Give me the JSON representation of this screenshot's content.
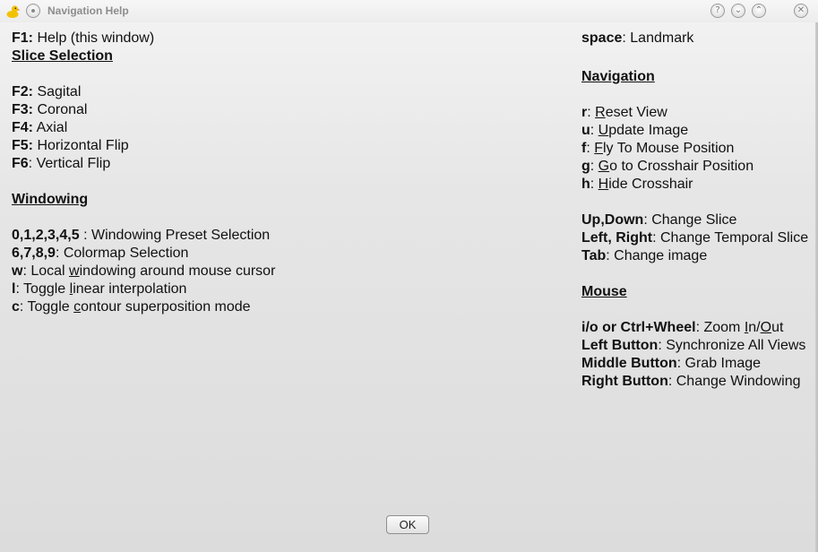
{
  "window": {
    "title": "Navigation Help",
    "buttons": {
      "help": "?",
      "minimize": "⌄",
      "maximize": "⌃",
      "close": "✕"
    }
  },
  "left": {
    "f1": {
      "key": "F1:",
      "desc": " Help (this window)"
    },
    "slice_heading": "Slice Selection",
    "slice_items": [
      {
        "key": "F2:",
        "desc": " Sagital"
      },
      {
        "key": "F3:",
        "desc": " Coronal"
      },
      {
        "key": "F4:",
        "desc": " Axial"
      },
      {
        "key": "F5:",
        "desc": " Horizontal Flip"
      },
      {
        "key": "F6",
        "desc": ": Vertical Flip"
      }
    ],
    "windowing_heading": "Windowing",
    "windowing_items": [
      {
        "key": "0,1,2,3,4,5",
        "pre": " : Windowing Preset Selection",
        "u": "",
        "post": ""
      },
      {
        "key": "6,7,8,9",
        "pre": ": Colormap Selection",
        "u": "",
        "post": ""
      },
      {
        "key": "w",
        "pre": ": Local ",
        "u": "w",
        "post": "indowing around mouse cursor"
      },
      {
        "key": "l",
        "pre": ": Toggle ",
        "u": "l",
        "post": "inear interpolation"
      },
      {
        "key": "c",
        "pre": ": Toggle ",
        "u": "c",
        "post": "ontour superposition mode"
      }
    ]
  },
  "right": {
    "space": {
      "key": "space",
      "desc": ": Landmark"
    },
    "navigation_heading": "Navigation",
    "navigation_items": [
      {
        "key": "r",
        "pre": ": ",
        "u": "R",
        "post": "eset View"
      },
      {
        "key": "u",
        "pre": ": ",
        "u": "U",
        "post": "pdate Image"
      },
      {
        "key": "f",
        "pre": ": ",
        "u": "F",
        "post": "ly To Mouse Position"
      },
      {
        "key": "g",
        "pre": ": ",
        "u": "G",
        "post": "o to Crosshair Position"
      },
      {
        "key": "h",
        "pre": ": ",
        "u": "H",
        "post": "ide Crosshair"
      }
    ],
    "arrow_items": [
      {
        "key": "Up,Down",
        "desc": ": Change Slice"
      },
      {
        "key": "Left, Right",
        "desc": ": Change Temporal Slice"
      },
      {
        "key": "Tab",
        "desc": ": Change image"
      }
    ],
    "mouse_heading": "Mouse",
    "mouse_items": [
      {
        "key": "i/o or Ctrl+Wheel",
        "pre": ": Zoom ",
        "u1": "I",
        "mid": "n/",
        "u2": "O",
        "post": "ut"
      },
      {
        "key": "Left Button",
        "desc": ": Synchronize All Views"
      },
      {
        "key": "Middle Button",
        "desc": ": Grab Image"
      },
      {
        "key": "Right Button",
        "desc": ": Change Windowing"
      }
    ]
  },
  "ok_label": "OK",
  "colors": {
    "title_text": "#8d8d8d",
    "duck_yellow": "#f2c200"
  }
}
